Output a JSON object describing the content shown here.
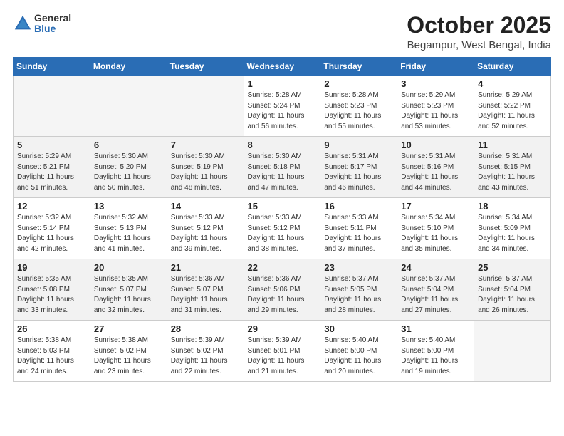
{
  "header": {
    "logo_general": "General",
    "logo_blue": "Blue",
    "month_year": "October 2025",
    "location": "Begampur, West Bengal, India"
  },
  "weekdays": [
    "Sunday",
    "Monday",
    "Tuesday",
    "Wednesday",
    "Thursday",
    "Friday",
    "Saturday"
  ],
  "weeks": [
    [
      {
        "day": "",
        "info": ""
      },
      {
        "day": "",
        "info": ""
      },
      {
        "day": "",
        "info": ""
      },
      {
        "day": "1",
        "info": "Sunrise: 5:28 AM\nSunset: 5:24 PM\nDaylight: 11 hours\nand 56 minutes."
      },
      {
        "day": "2",
        "info": "Sunrise: 5:28 AM\nSunset: 5:23 PM\nDaylight: 11 hours\nand 55 minutes."
      },
      {
        "day": "3",
        "info": "Sunrise: 5:29 AM\nSunset: 5:23 PM\nDaylight: 11 hours\nand 53 minutes."
      },
      {
        "day": "4",
        "info": "Sunrise: 5:29 AM\nSunset: 5:22 PM\nDaylight: 11 hours\nand 52 minutes."
      }
    ],
    [
      {
        "day": "5",
        "info": "Sunrise: 5:29 AM\nSunset: 5:21 PM\nDaylight: 11 hours\nand 51 minutes."
      },
      {
        "day": "6",
        "info": "Sunrise: 5:30 AM\nSunset: 5:20 PM\nDaylight: 11 hours\nand 50 minutes."
      },
      {
        "day": "7",
        "info": "Sunrise: 5:30 AM\nSunset: 5:19 PM\nDaylight: 11 hours\nand 48 minutes."
      },
      {
        "day": "8",
        "info": "Sunrise: 5:30 AM\nSunset: 5:18 PM\nDaylight: 11 hours\nand 47 minutes."
      },
      {
        "day": "9",
        "info": "Sunrise: 5:31 AM\nSunset: 5:17 PM\nDaylight: 11 hours\nand 46 minutes."
      },
      {
        "day": "10",
        "info": "Sunrise: 5:31 AM\nSunset: 5:16 PM\nDaylight: 11 hours\nand 44 minutes."
      },
      {
        "day": "11",
        "info": "Sunrise: 5:31 AM\nSunset: 5:15 PM\nDaylight: 11 hours\nand 43 minutes."
      }
    ],
    [
      {
        "day": "12",
        "info": "Sunrise: 5:32 AM\nSunset: 5:14 PM\nDaylight: 11 hours\nand 42 minutes."
      },
      {
        "day": "13",
        "info": "Sunrise: 5:32 AM\nSunset: 5:13 PM\nDaylight: 11 hours\nand 41 minutes."
      },
      {
        "day": "14",
        "info": "Sunrise: 5:33 AM\nSunset: 5:12 PM\nDaylight: 11 hours\nand 39 minutes."
      },
      {
        "day": "15",
        "info": "Sunrise: 5:33 AM\nSunset: 5:12 PM\nDaylight: 11 hours\nand 38 minutes."
      },
      {
        "day": "16",
        "info": "Sunrise: 5:33 AM\nSunset: 5:11 PM\nDaylight: 11 hours\nand 37 minutes."
      },
      {
        "day": "17",
        "info": "Sunrise: 5:34 AM\nSunset: 5:10 PM\nDaylight: 11 hours\nand 35 minutes."
      },
      {
        "day": "18",
        "info": "Sunrise: 5:34 AM\nSunset: 5:09 PM\nDaylight: 11 hours\nand 34 minutes."
      }
    ],
    [
      {
        "day": "19",
        "info": "Sunrise: 5:35 AM\nSunset: 5:08 PM\nDaylight: 11 hours\nand 33 minutes."
      },
      {
        "day": "20",
        "info": "Sunrise: 5:35 AM\nSunset: 5:07 PM\nDaylight: 11 hours\nand 32 minutes."
      },
      {
        "day": "21",
        "info": "Sunrise: 5:36 AM\nSunset: 5:07 PM\nDaylight: 11 hours\nand 31 minutes."
      },
      {
        "day": "22",
        "info": "Sunrise: 5:36 AM\nSunset: 5:06 PM\nDaylight: 11 hours\nand 29 minutes."
      },
      {
        "day": "23",
        "info": "Sunrise: 5:37 AM\nSunset: 5:05 PM\nDaylight: 11 hours\nand 28 minutes."
      },
      {
        "day": "24",
        "info": "Sunrise: 5:37 AM\nSunset: 5:04 PM\nDaylight: 11 hours\nand 27 minutes."
      },
      {
        "day": "25",
        "info": "Sunrise: 5:37 AM\nSunset: 5:04 PM\nDaylight: 11 hours\nand 26 minutes."
      }
    ],
    [
      {
        "day": "26",
        "info": "Sunrise: 5:38 AM\nSunset: 5:03 PM\nDaylight: 11 hours\nand 24 minutes."
      },
      {
        "day": "27",
        "info": "Sunrise: 5:38 AM\nSunset: 5:02 PM\nDaylight: 11 hours\nand 23 minutes."
      },
      {
        "day": "28",
        "info": "Sunrise: 5:39 AM\nSunset: 5:02 PM\nDaylight: 11 hours\nand 22 minutes."
      },
      {
        "day": "29",
        "info": "Sunrise: 5:39 AM\nSunset: 5:01 PM\nDaylight: 11 hours\nand 21 minutes."
      },
      {
        "day": "30",
        "info": "Sunrise: 5:40 AM\nSunset: 5:00 PM\nDaylight: 11 hours\nand 20 minutes."
      },
      {
        "day": "31",
        "info": "Sunrise: 5:40 AM\nSunset: 5:00 PM\nDaylight: 11 hours\nand 19 minutes."
      },
      {
        "day": "",
        "info": ""
      }
    ]
  ]
}
